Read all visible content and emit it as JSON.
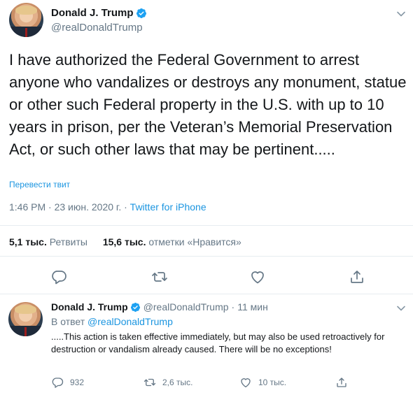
{
  "main_tweet": {
    "author": {
      "name": "Donald J. Trump",
      "handle": "@realDonaldTrump",
      "verified": true
    },
    "text": "I have authorized the Federal Government to arrest anyone who vandalizes or destroys any monument, statue or other such Federal property in the U.S. with up to 10 years in prison, per the Veteran’s Memorial Preservation Act, or such other laws that may be pertinent.....",
    "translate_label": "Перевести твит",
    "time": "1:46 PM",
    "date": "23 июн. 2020 г.",
    "separator": "·",
    "source": "Twitter for iPhone",
    "stats": {
      "retweets_count": "5,1 тыс.",
      "retweets_label": "Ретвиты",
      "likes_count": "15,6 тыс.",
      "likes_label": "отметки «Нравится»"
    },
    "actions": [
      "reply-icon",
      "retweet-icon",
      "like-icon",
      "share-icon"
    ]
  },
  "reply_tweet": {
    "author": {
      "name": "Donald J. Trump",
      "handle": "@realDonaldTrump",
      "verified": true
    },
    "time_sep": "·",
    "time_ago": "11 мин",
    "reply_prefix": "В ответ",
    "reply_to": "@realDonaldTrump",
    "text": ".....This action is taken effective immediately, but may also be used retroactively for destruction or vandalism already caused. There will be no exceptions!",
    "counts": {
      "replies": "932",
      "retweets": "2,6 тыс.",
      "likes": "10 тыс."
    }
  },
  "colors": {
    "accent": "#1b95e0",
    "verified": "#1da1f2",
    "muted": "#657786",
    "text": "#14171a",
    "divider": "#e6ecf0"
  }
}
